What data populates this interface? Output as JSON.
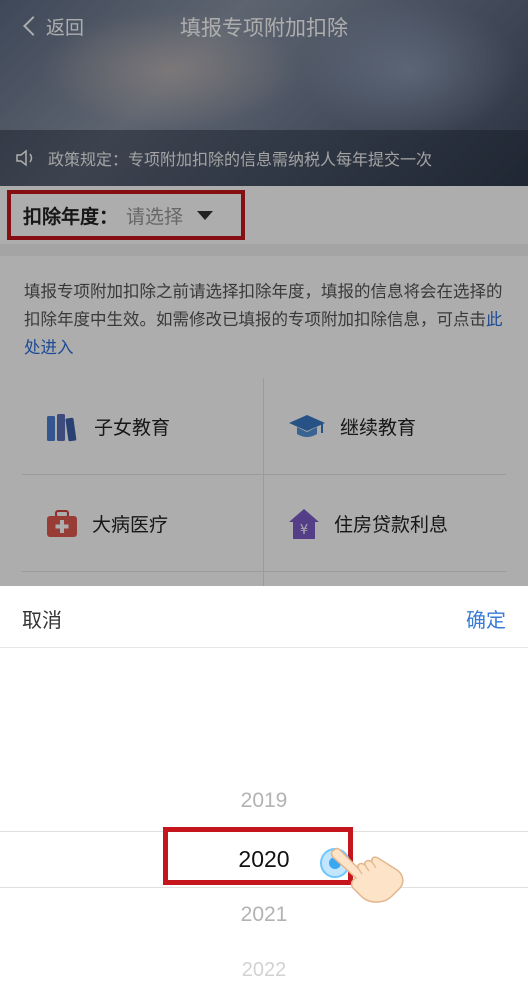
{
  "nav": {
    "back_label": "返回",
    "title": "填报专项附加扣除"
  },
  "policy": {
    "text": "政策规定：专项附加扣除的信息需纳税人每年提交一次"
  },
  "year_selector": {
    "label": "扣除年度：",
    "value": "请选择"
  },
  "description": {
    "text": "填报专项附加扣除之前请选择扣除年度，填报的信息将会在选择的扣除年度中生效。如需修改已填报的专项附加扣除信息，可点击",
    "link": "此处进入"
  },
  "categories": [
    {
      "label": "子女教育",
      "icon": "books-icon"
    },
    {
      "label": "继续教育",
      "icon": "graduation-cap-icon"
    },
    {
      "label": "大病医疗",
      "icon": "medical-kit-icon"
    },
    {
      "label": "住房贷款利息",
      "icon": "house-yuan-icon"
    }
  ],
  "picker": {
    "cancel_label": "取消",
    "confirm_label": "确定",
    "options": [
      "2019",
      "2020",
      "2021",
      "2022"
    ],
    "selected": "2020"
  },
  "colors": {
    "highlight": "#c4161c",
    "link": "#2c6fdb",
    "confirm": "#3a7bd5"
  }
}
